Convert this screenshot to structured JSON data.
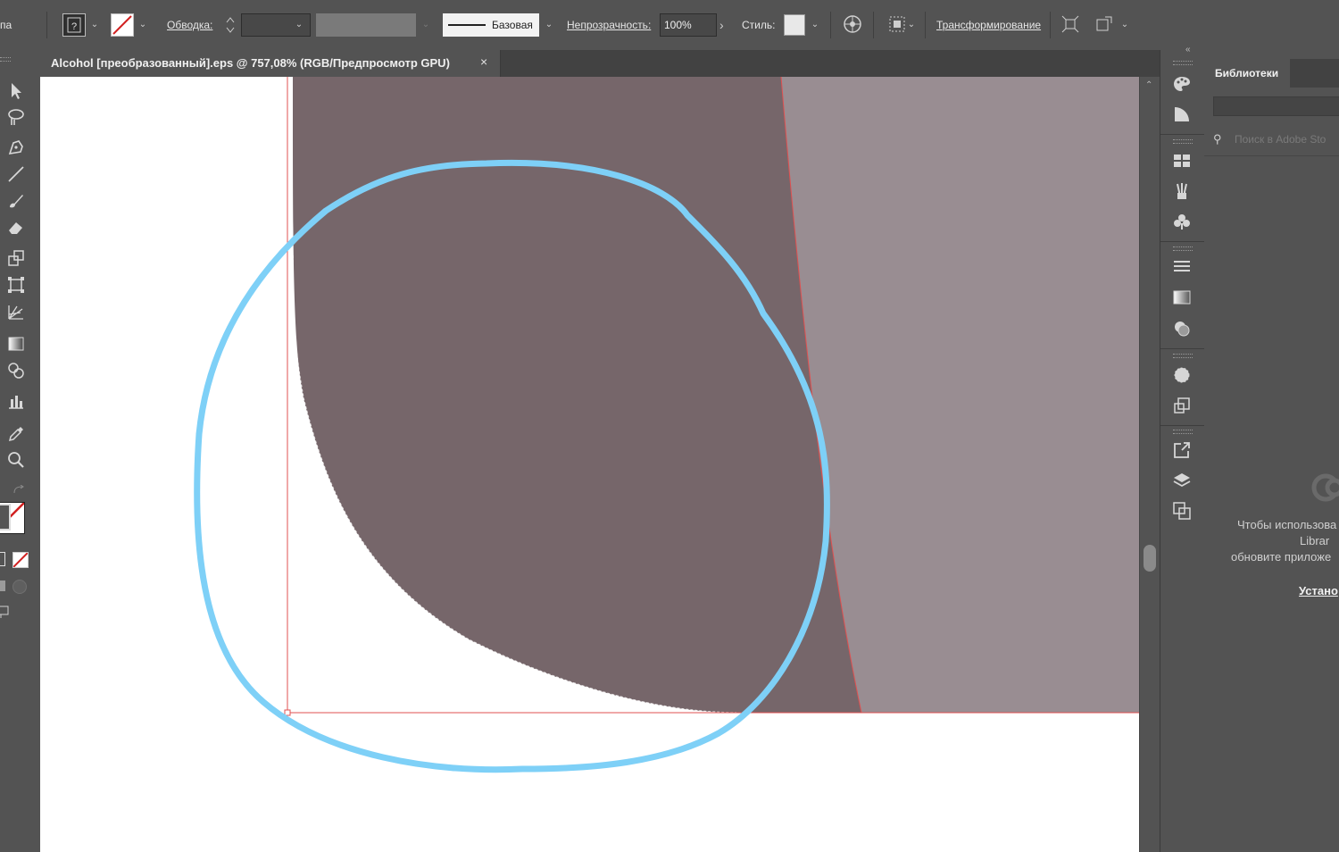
{
  "control_bar": {
    "partial_label": "па",
    "stroke_label": "Обводка:",
    "stroke_profile_label": "Базовая",
    "opacity_label": "Непрозрачность:",
    "opacity_value": "100%",
    "style_label": "Стиль:",
    "transform_label": "Трансформирование"
  },
  "document": {
    "tab_title": "Alcohol [преобразованный].eps @ 757,08% (RGB/Предпросмотр GPU)",
    "tab_close": "×"
  },
  "colors": {
    "dark_shape": "#76666a",
    "light_shape": "#998d92",
    "annotation_circle": "#7ed0f7",
    "artboard_edge": "#e05050"
  },
  "libraries": {
    "title": "Библиотеки",
    "search_placeholder": "Поиск в Adobe Sto",
    "message_line1": "Чтобы использова",
    "message_line2": "Librar",
    "message_line3": "обновите приложе",
    "install_link": "Устано"
  },
  "icons": {
    "tools": [
      "selection-icon",
      "lasso-icon",
      "pen-icon",
      "line-icon",
      "brush-icon",
      "eraser-icon",
      "scale-icon",
      "free-transform-icon",
      "perspective-grid-icon",
      "gradient-icon",
      "shape-builder-icon",
      "graph-icon",
      "eyedropper-icon",
      "zoom-icon"
    ],
    "dock": [
      "color-icon",
      "color-guide-icon",
      "swatches-icon",
      "brushes-icon",
      "symbols-icon",
      "stroke-icon",
      "gradient-panel-icon",
      "transparency-icon",
      "appearance-icon",
      "graphic-styles-icon",
      "export-icon",
      "layers-icon",
      "artboards-icon"
    ]
  }
}
